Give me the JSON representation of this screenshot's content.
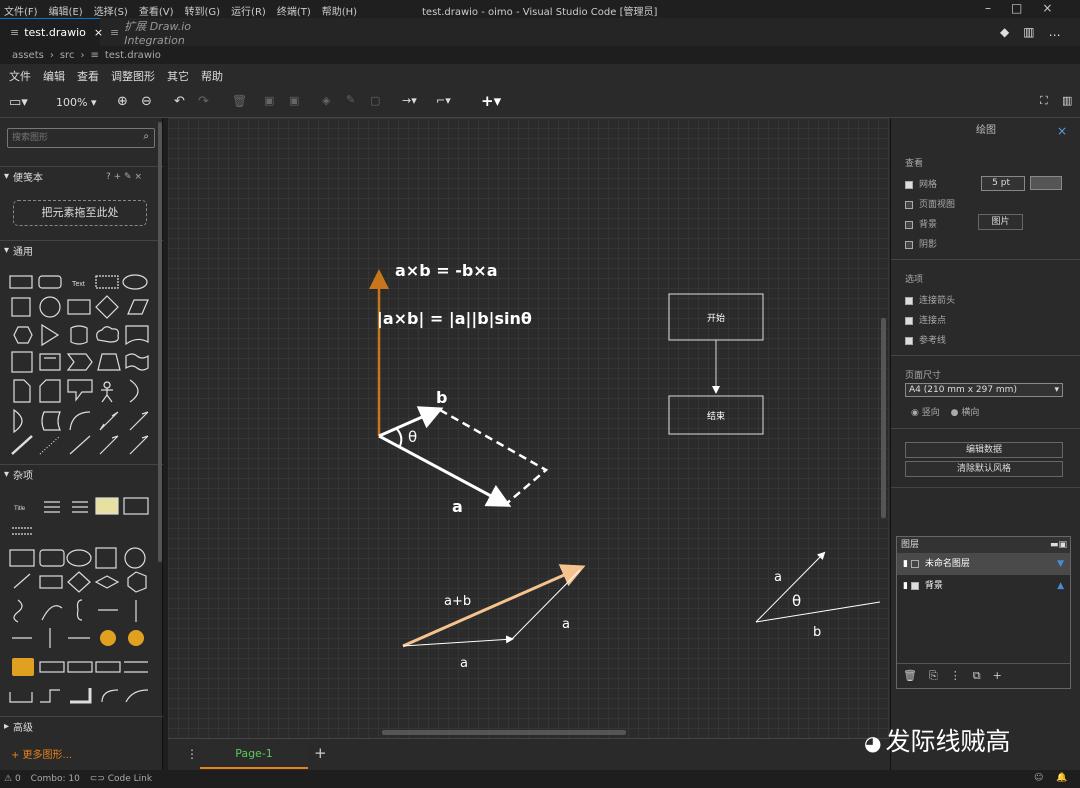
{
  "window": {
    "title": "test.drawio - oimo - Visual Studio Code [管理员]",
    "menu": [
      "文件(F)",
      "编辑(E)",
      "选择(S)",
      "查看(V)",
      "转到(G)",
      "运行(R)",
      "终端(T)",
      "帮助(H)"
    ]
  },
  "tabs": [
    {
      "label": "test.drawio",
      "active": true
    },
    {
      "label": "扩展 Draw.io Integration",
      "active": false
    }
  ],
  "breadcrumb": [
    "assets",
    "src",
    "test.drawio"
  ],
  "app_menu": [
    "文件",
    "编辑",
    "查看",
    "调整图形",
    "其它",
    "帮助"
  ],
  "toolbar": {
    "zoom": "100%"
  },
  "left": {
    "search_placeholder": "搜索图形",
    "scratchpad": "便笺本",
    "scratch_drop": "把元素拖至此处",
    "general": "通用",
    "misc": "杂项",
    "advanced": "高级",
    "more_shapes": "+ 更多图形...",
    "text_shape": "Text",
    "title_shape": "Title"
  },
  "canvas": {
    "formula1": "a×b = -b×a",
    "formula2": "|a×b| = |a||b|sinθ",
    "label_b": "b",
    "label_theta": "θ",
    "label_a": "a",
    "label_ab": "a+b",
    "label_a2": "a",
    "label_a3": "a",
    "label_a4": "a",
    "label_theta2": "θ",
    "label_b2": "b",
    "flow_start": "开始",
    "flow_end": "结束",
    "colors": {
      "orange": "#c8761b",
      "peach": "#f6c38f",
      "white": "#ffffff"
    }
  },
  "right": {
    "title": "绘图",
    "view": "查看",
    "grid": "网格",
    "grid_size": "5 pt",
    "page_view": "页面视图",
    "background": "背景",
    "image_btn": "图片",
    "shadow": "阴影",
    "options": "选项",
    "connect_arrows": "连接箭头",
    "connect_points": "连接点",
    "guides": "参考线",
    "page_size": "页面尺寸",
    "page_size_value": "A4 (210 mm x 297 mm)",
    "portrait": "竖向",
    "landscape": "横向",
    "edit_data": "编辑数据",
    "clear_style": "清除默认风格"
  },
  "layers": {
    "title": "图层",
    "items": [
      "未命名图层",
      "背景"
    ]
  },
  "pagebar": {
    "page": "Page-1"
  },
  "status": {
    "problems": "0",
    "combo": "Combo: 10",
    "codelink": "Code Link"
  },
  "watermark": "发际线贼高"
}
